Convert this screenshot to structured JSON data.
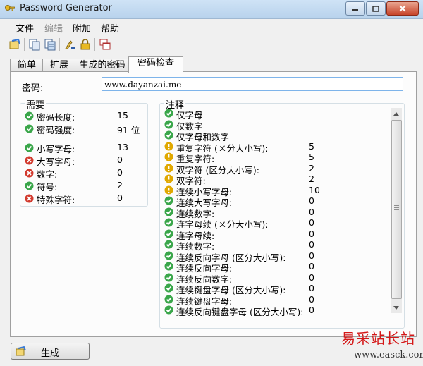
{
  "window": {
    "title": "Password Generator"
  },
  "menu": {
    "items": [
      {
        "label": "文件",
        "enabled": true
      },
      {
        "label": "编辑",
        "enabled": false
      },
      {
        "label": "附加",
        "enabled": true
      },
      {
        "label": "帮助",
        "enabled": true
      }
    ]
  },
  "toolbar": {
    "icons": [
      "generate-icon",
      "copy-icon",
      "copy-all-icon",
      "clear-icon",
      "lock-icon",
      "windows-icon"
    ]
  },
  "tabs": [
    {
      "label": "简单",
      "active": false
    },
    {
      "label": "扩展",
      "active": false
    },
    {
      "label": "生成的密码",
      "active": false
    },
    {
      "label": "密码检查",
      "active": true
    }
  ],
  "password": {
    "label": "密码:",
    "value": "www.dayanzai.me"
  },
  "requirements": {
    "title": "需要",
    "rows": [
      {
        "status": "ok",
        "label": "密码长度:",
        "value": "15"
      },
      {
        "status": "ok",
        "label": "密码强度:",
        "value": "91 位"
      },
      {
        "status": "ok",
        "label": "小写字母:",
        "value": "13"
      },
      {
        "status": "error",
        "label": "大写字母:",
        "value": "0"
      },
      {
        "status": "error",
        "label": "数字:",
        "value": "0"
      },
      {
        "status": "ok",
        "label": "符号:",
        "value": "2"
      },
      {
        "status": "error",
        "label": "特殊字符:",
        "value": "0"
      }
    ]
  },
  "notes": {
    "title": "注释",
    "rows": [
      {
        "status": "ok",
        "label": "仅字母",
        "value": ""
      },
      {
        "status": "ok",
        "label": "仅数字",
        "value": ""
      },
      {
        "status": "ok",
        "label": "仅字母和数字",
        "value": ""
      },
      {
        "status": "warn",
        "label": "重复字符 (区分大小写):",
        "value": "5"
      },
      {
        "status": "warn",
        "label": "重复字符:",
        "value": "5"
      },
      {
        "status": "warn",
        "label": "双字符 (区分大小写):",
        "value": "2"
      },
      {
        "status": "warn",
        "label": "双字符:",
        "value": "2"
      },
      {
        "status": "warn",
        "label": "连续小写字母:",
        "value": "10"
      },
      {
        "status": "ok",
        "label": "连续大写字母:",
        "value": "0"
      },
      {
        "status": "ok",
        "label": "连续数字:",
        "value": "0"
      },
      {
        "status": "ok",
        "label": "连字母续 (区分大小写):",
        "value": "0"
      },
      {
        "status": "ok",
        "label": "连字母续:",
        "value": "0"
      },
      {
        "status": "ok",
        "label": "连续数字:",
        "value": "0"
      },
      {
        "status": "ok",
        "label": "连续反向字母 (区分大小写):",
        "value": "0"
      },
      {
        "status": "ok",
        "label": "连续反向字母:",
        "value": "0"
      },
      {
        "status": "ok",
        "label": "连续反向数字:",
        "value": "0"
      },
      {
        "status": "ok",
        "label": "连续键盘字母 (区分大小写):",
        "value": "0"
      },
      {
        "status": "ok",
        "label": "连续键盘字母:",
        "value": "0"
      },
      {
        "status": "ok",
        "label": "连续反向键盘字母 (区分大小写):",
        "value": "0"
      }
    ]
  },
  "footer": {
    "generate_label": "生成"
  },
  "watermark": {
    "cn": "易采站长站",
    "en": "www.easck.com"
  },
  "colors": {
    "ok": "#3aa64a",
    "warn": "#e0a800",
    "error": "#d23a2e",
    "accent": "#7eb4ea"
  }
}
